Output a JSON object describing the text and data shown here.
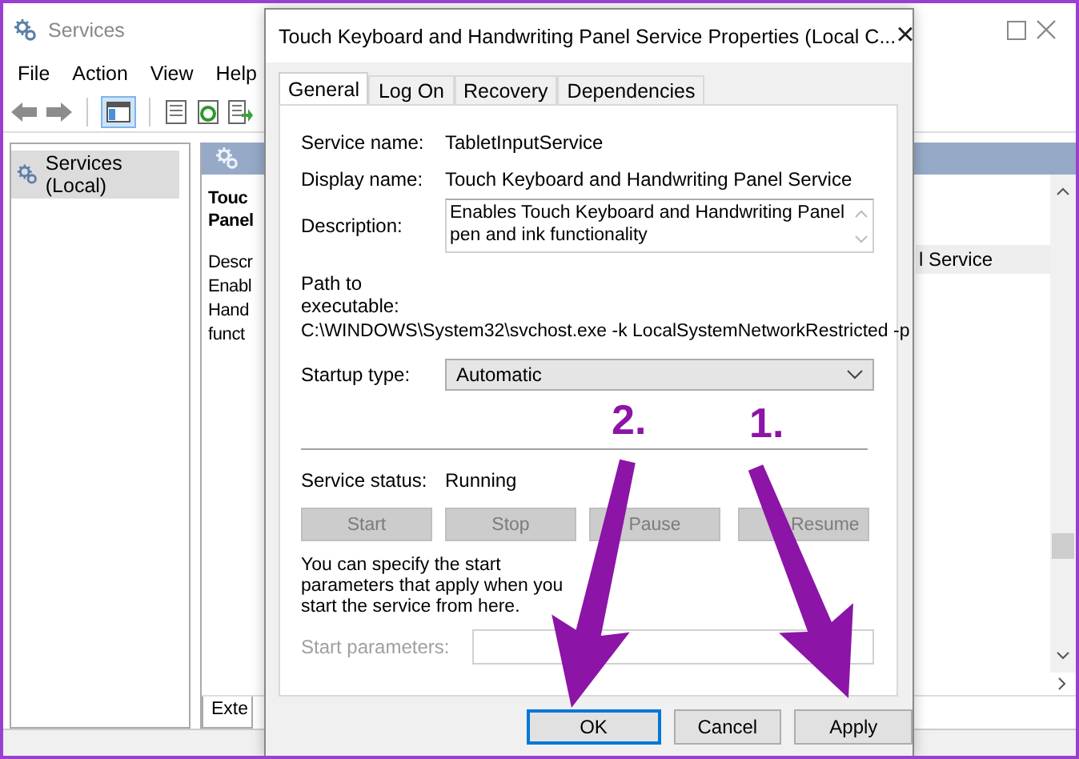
{
  "services_window": {
    "title": "Services",
    "menu": [
      "File",
      "Action",
      "View",
      "Help"
    ],
    "tree": [
      {
        "label": "Services (Local)",
        "selected": true
      }
    ],
    "detail_pane": {
      "title_lines": [
        "Touc",
        "Panel"
      ],
      "description_lines": [
        "Descr",
        "Enabl",
        "Hand",
        "funct"
      ]
    },
    "list_rows": [
      {
        "label": "l Service",
        "selected": true
      }
    ],
    "bottom_tabs": [
      {
        "label": "Exte"
      }
    ]
  },
  "dialog": {
    "title": "Touch Keyboard and Handwriting Panel Service Properties (Local C...",
    "close": "×",
    "tabs": [
      {
        "label": "General",
        "selected": true
      },
      {
        "label": "Log On",
        "selected": false
      },
      {
        "label": "Recovery",
        "selected": false
      },
      {
        "label": "Dependencies",
        "selected": false
      }
    ],
    "service_name": {
      "label": "Service name:",
      "value": "TabletInputService"
    },
    "display_name": {
      "label": "Display name:",
      "value": "Touch Keyboard and Handwriting Panel Service"
    },
    "description": {
      "label": "Description:",
      "value": "Enables Touch Keyboard and Handwriting Panel pen and ink functionality"
    },
    "path": {
      "label": "Path to executable:",
      "value": "C:\\WINDOWS\\System32\\svchost.exe -k LocalSystemNetworkRestricted -p"
    },
    "startup_type": {
      "label": "Startup type:",
      "value": "Automatic"
    },
    "service_status": {
      "label": "Service status:",
      "value": "Running"
    },
    "service_buttons": [
      {
        "label": "Start",
        "disabled": true
      },
      {
        "label": "Stop",
        "disabled": true
      },
      {
        "label": "Pause",
        "disabled": true
      },
      {
        "label": "Resume",
        "disabled": true
      }
    ],
    "hint": "You can specify the start parameters that apply when you start the service from here.",
    "start_parameters": {
      "label": "Start parameters:",
      "disabled": true
    },
    "buttons": [
      {
        "label": "OK",
        "selected": true
      },
      {
        "label": "Cancel",
        "selected": false
      },
      {
        "label": "Apply",
        "selected": false
      }
    ]
  },
  "annotations": [
    {
      "label": "2."
    },
    {
      "label": "1."
    }
  ]
}
